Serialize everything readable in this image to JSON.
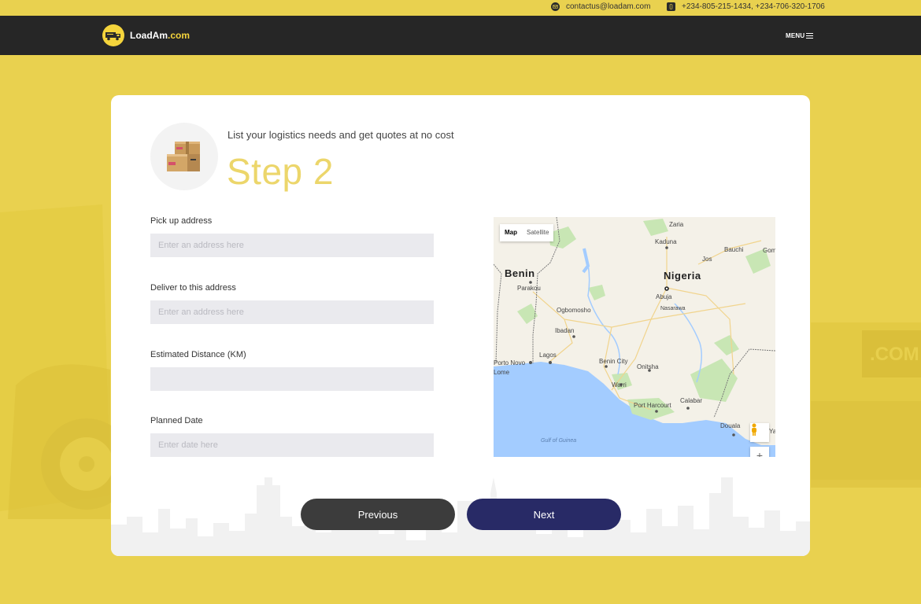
{
  "topbar": {
    "email": "contactus@loadam.com",
    "phone": "+234-805-215-1434, +234-706-320-1706"
  },
  "nav": {
    "brand": "LoadAm",
    "brand_suffix": ".com",
    "menu_label": "MENU"
  },
  "form": {
    "subtitle": "List your logistics needs and get quotes at no cost",
    "step_title": "Step 2",
    "fields": [
      {
        "label": "Pick up address",
        "placeholder": "Enter an address here",
        "value": ""
      },
      {
        "label": "Deliver to this address",
        "placeholder": "Enter an address here",
        "value": ""
      },
      {
        "label": "Estimated Distance (KM)",
        "placeholder": "",
        "value": ""
      },
      {
        "label": "Planned Date",
        "placeholder": "Enter date here",
        "value": ""
      }
    ],
    "prev_label": "Previous",
    "next_label": "Next"
  },
  "map": {
    "tabs": [
      "Map",
      "Satellite"
    ],
    "active_tab": "Map",
    "countries": [
      "Benin",
      "Nigeria"
    ],
    "cities": [
      "Zaria",
      "Kaduna",
      "Bauchi",
      "Gom",
      "Jos",
      "Parakou",
      "Abuja",
      "Nasarawa",
      "Ogbomosho",
      "Ibadan",
      "Lagos",
      "Porto Novo",
      "Lome",
      "Benin City",
      "Onitsha",
      "Warri",
      "Port Harcourt",
      "Calabar",
      "Douala",
      "Ya"
    ],
    "water": "Gulf of Guinea",
    "zoom_label": "+"
  },
  "colors": {
    "background": "#e9d14f",
    "navbar": "#262626",
    "step_accent": "#ecd66b",
    "next_button": "#282a66",
    "prev_button": "#3c3c3c"
  }
}
